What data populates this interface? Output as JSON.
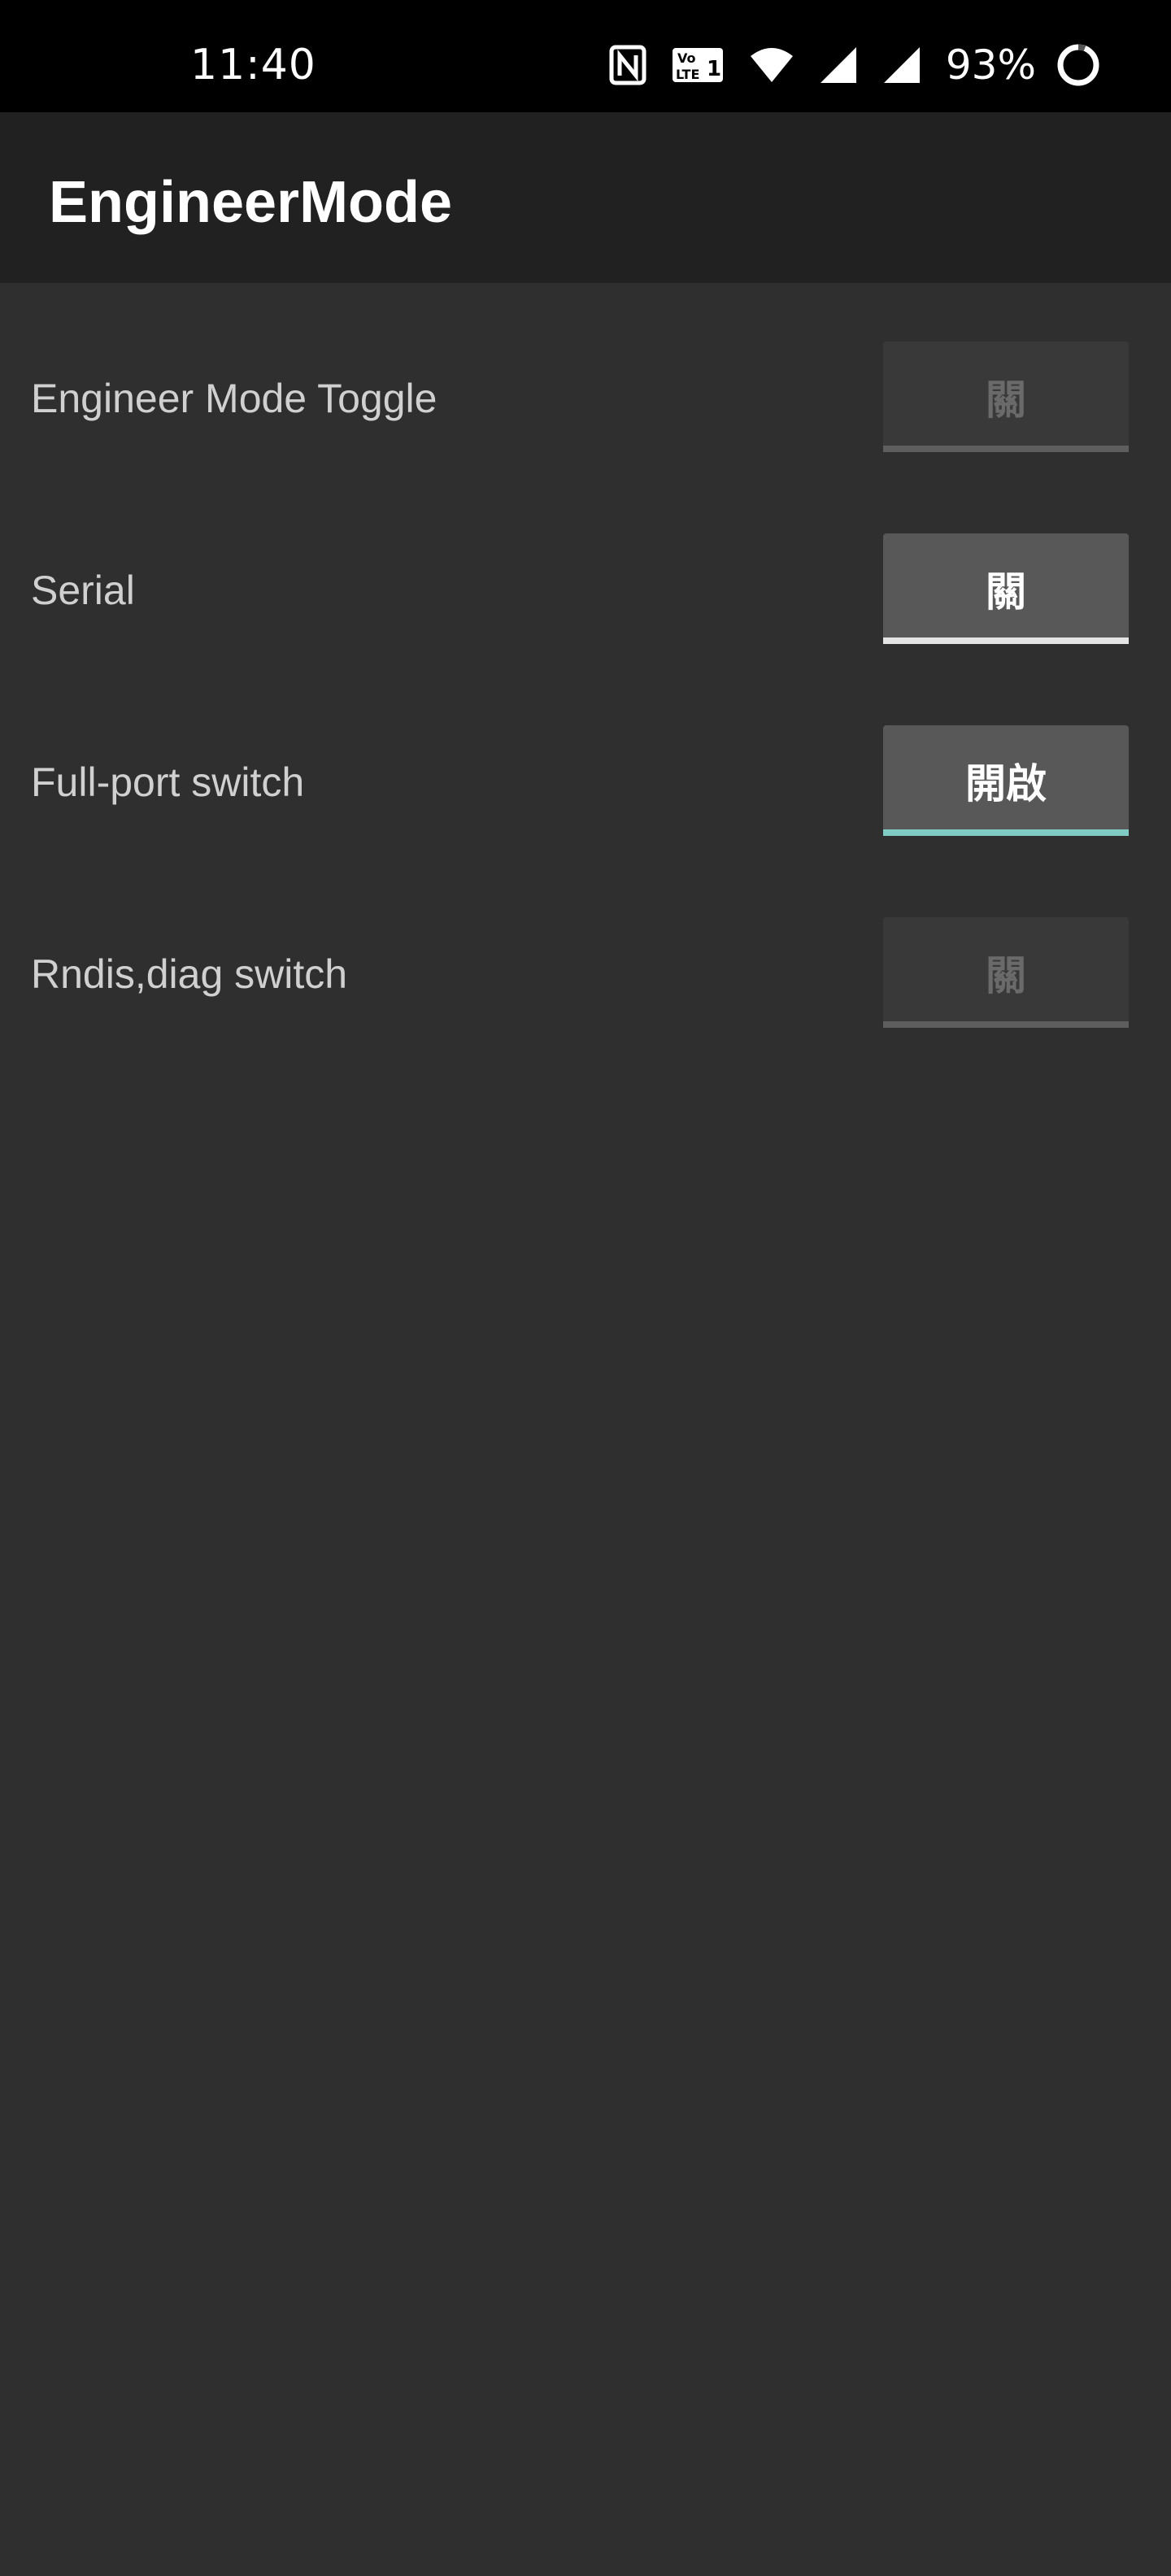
{
  "status_bar": {
    "time": "11:40",
    "battery_percent": "93%",
    "icons": [
      "nfc-icon",
      "volte-icon",
      "wifi-icon",
      "signal-icon",
      "signal-icon",
      "battery-icon"
    ]
  },
  "app": {
    "title": "EngineerMode"
  },
  "rows": [
    {
      "label": "Engineer Mode Toggle",
      "button": "關",
      "state": "disabled"
    },
    {
      "label": "Serial",
      "button": "關",
      "state": "enabled"
    },
    {
      "label": "Full-port switch",
      "button": "開啟",
      "state": "on"
    },
    {
      "label": "Rndis,diag switch",
      "button": "關",
      "state": "disabled"
    }
  ],
  "colors": {
    "status_bar_bg": "#000000",
    "app_bar_bg": "#212121",
    "content_bg": "#2f2f2f",
    "accent_on": "#80cbc4"
  }
}
